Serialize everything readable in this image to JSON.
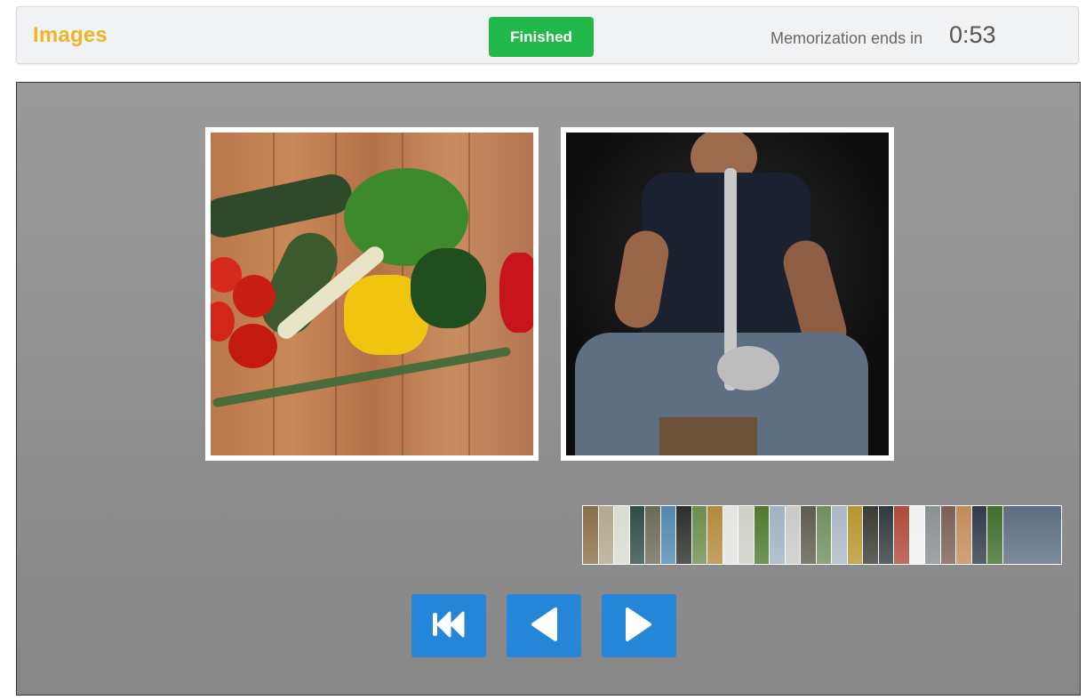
{
  "header": {
    "title": "Images",
    "finished_label": "Finished",
    "timer_label": "Memorization ends in",
    "timer_value": "0:53"
  },
  "stage": {
    "images": [
      {
        "name": "vegetables-image",
        "icon": "vegetables-photo"
      },
      {
        "name": "saxophone-player-image",
        "icon": "saxophone-photo"
      }
    ],
    "filmstrip_colors": [
      "#8a6f4a",
      "#b2a88c",
      "#d9dcd2",
      "#2f4d48",
      "#6e6a59",
      "#4f88b0",
      "#2b2e2a",
      "#6c8c4f",
      "#b38a3d",
      "#e3e3e1",
      "#cfcfc9",
      "#4d7a2e",
      "#9fb3c1",
      "#c9c9c9",
      "#5f5b51",
      "#6f8f5e",
      "#aab8c6",
      "#b8952e",
      "#3b3a33",
      "#2f3a40",
      "#b04a38",
      "#f0f0f0",
      "#8a8f92",
      "#7c5f52",
      "#c48b5b",
      "#2f3b4a",
      "#3f6e2a",
      "#5b6d80"
    ],
    "buttons": {
      "first": "skip-to-first-icon",
      "prev": "previous-icon",
      "next": "next-icon"
    }
  },
  "colors": {
    "accent_title": "#f0b429",
    "finished_green": "#22b84a",
    "nav_blue": "#2585d6"
  }
}
